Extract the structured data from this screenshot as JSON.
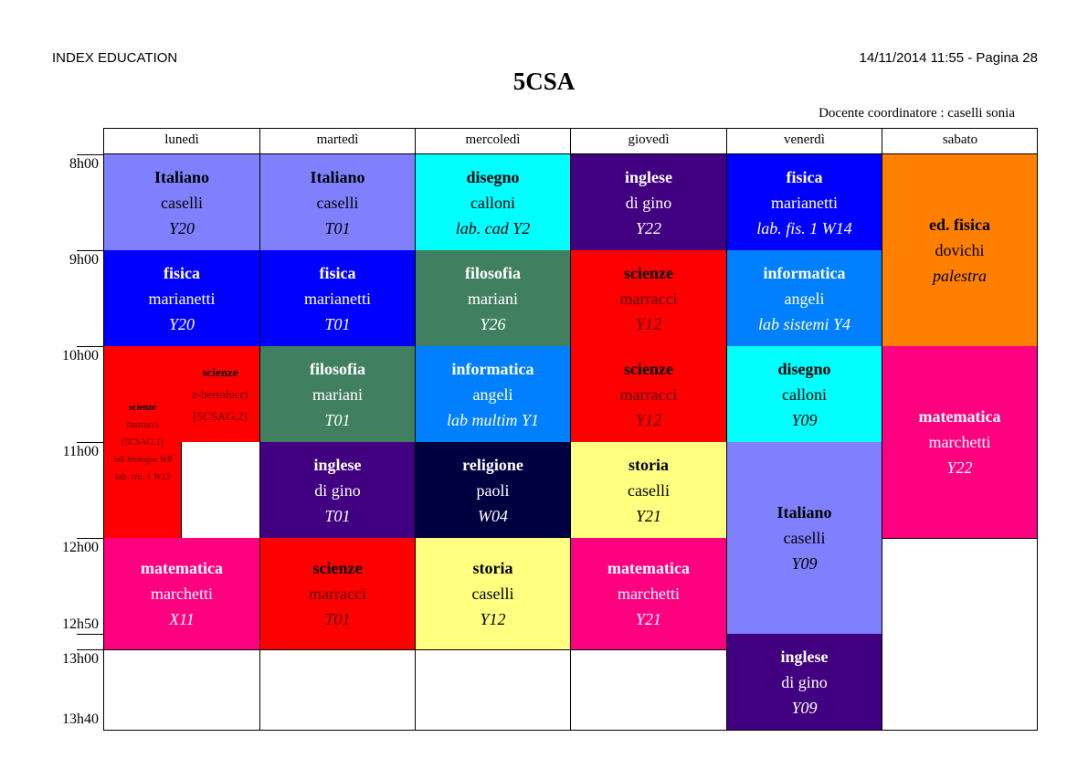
{
  "header": {
    "left": "INDEX EDUCATION",
    "right": "14/11/2014 11:55 - Pagina 28",
    "title": "5CSA",
    "coordinator": "Docente coordinatore : caselli sonia"
  },
  "days": [
    "lunedì",
    "martedì",
    "mercoledì",
    "giovedì",
    "venerdì",
    "sabato"
  ],
  "times": [
    "8h00",
    "9h00",
    "10h00",
    "11h00",
    "12h00",
    "12h50",
    "13h00",
    "13h40"
  ],
  "colors": {
    "lavender": "#8080ff",
    "blue": "#0000ff",
    "cyan": "#00ffff",
    "purple": "#400080",
    "red": "#ff0000",
    "green": "#408060",
    "azure": "#0080ff",
    "orange": "#ff8000",
    "navy": "#000040",
    "yellow": "#ffff80",
    "pink": "#ff0080"
  },
  "lessons": {
    "mon_1": {
      "subject": "Italiano",
      "teacher": "caselli",
      "room": "Y20"
    },
    "mon_2": {
      "subject": "fisica",
      "teacher": "marianetti",
      "room": "Y20"
    },
    "mon_3a": {
      "subject": "scienze",
      "teacher": "marracci",
      "group": "[5CSAG.1]",
      "room": "lab biologia W8",
      "room2": "lab. chi. 1 W13"
    },
    "mon_3b": {
      "subject": "scienze",
      "teacher": "z-bertolucci",
      "group": "[5CSAG.2]"
    },
    "mon_5": {
      "subject": "matematica",
      "teacher": "marchetti",
      "room": "X11"
    },
    "tue_1": {
      "subject": "Italiano",
      "teacher": "caselli",
      "room": "T01"
    },
    "tue_2": {
      "subject": "fisica",
      "teacher": "marianetti",
      "room": "T01"
    },
    "tue_3": {
      "subject": "filosofia",
      "teacher": "mariani",
      "room": "T01"
    },
    "tue_4": {
      "subject": "inglese",
      "teacher": "di gino",
      "room": "T01"
    },
    "tue_5": {
      "subject": "scienze",
      "teacher": "marracci",
      "room": "T01"
    },
    "wed_1": {
      "subject": "disegno",
      "teacher": "calloni",
      "room": "lab. cad Y2"
    },
    "wed_2": {
      "subject": "filosofia",
      "teacher": "mariani",
      "room": "Y26"
    },
    "wed_3": {
      "subject": "informatica",
      "teacher": "angeli",
      "room": "lab multim Y1"
    },
    "wed_4": {
      "subject": "religione",
      "teacher": "paoli",
      "room": "W04"
    },
    "wed_5": {
      "subject": "storia",
      "teacher": "caselli",
      "room": "Y12"
    },
    "thu_1": {
      "subject": "inglese",
      "teacher": "di gino",
      "room": "Y22"
    },
    "thu_2": {
      "subject": "scienze",
      "teacher": "marracci",
      "room": "Y12"
    },
    "thu_3": {
      "subject": "scienze",
      "teacher": "marracci",
      "room": "Y12"
    },
    "thu_4": {
      "subject": "storia",
      "teacher": "caselli",
      "room": "Y21"
    },
    "thu_5": {
      "subject": "matematica",
      "teacher": "marchetti",
      "room": "Y21"
    },
    "fri_1": {
      "subject": "fisica",
      "teacher": "marianetti",
      "room": "lab. fis. 1 W14"
    },
    "fri_2": {
      "subject": "informatica",
      "teacher": "angeli",
      "room": "lab sistemi Y4"
    },
    "fri_3": {
      "subject": "disegno",
      "teacher": "calloni",
      "room": "Y09"
    },
    "fri_4": {
      "subject": "Italiano",
      "teacher": "caselli",
      "room": "Y09"
    },
    "fri_6": {
      "subject": "inglese",
      "teacher": "di gino",
      "room": "Y09"
    },
    "sat_1": {
      "subject": "ed. fisica",
      "teacher": "dovichi",
      "room": "palestra"
    },
    "sat_3": {
      "subject": "matematica",
      "teacher": "marchetti",
      "room": "Y22"
    }
  }
}
